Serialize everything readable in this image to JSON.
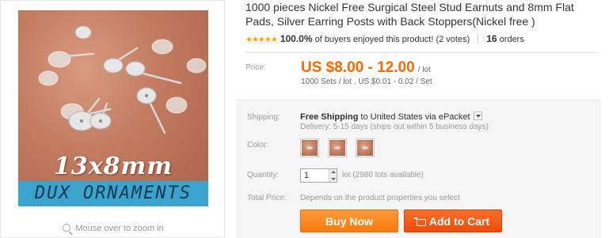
{
  "product": {
    "title": "1000 pieces Nickel Free Surgical Steel Stud Earnuts and 8mm Flat Pads, Silver Earring Posts with Back Stoppers(Nickel free )",
    "image_overlay_size": "13x8mm",
    "image_overlay_brand": "DUX ORNAMENTS",
    "zoom_hint": "Mouse over to zoom in"
  },
  "rating": {
    "stars": "★★★★★",
    "percent": "100.0%",
    "text": " of buyers enjoyed this product! (2 votes)",
    "orders_count": "16",
    "orders_label": " orders",
    "star_color": "#f7a20d"
  },
  "price": {
    "label": "Price:",
    "value": "US $8.00 - 12.00",
    "unit": "/ lot",
    "sub": "1000 Sets / lot , US $0.01 - 0.02 / Set",
    "color": "#ff6600"
  },
  "shipping": {
    "label": "Shipping:",
    "free": "Free Shipping",
    "to": " to ",
    "destination": "United States via ePacket",
    "delivery": "Delivery: 5-15 days (ships out within 5 business days)"
  },
  "color": {
    "label": "Color:",
    "swatches": [
      "swatch-1",
      "swatch-2",
      "swatch-3"
    ]
  },
  "quantity": {
    "label": "Quantity:",
    "value": "1",
    "unit_text": "lot (2980 lots available)"
  },
  "total": {
    "label": "Total Price:",
    "text": "Depends on the product properties you select"
  },
  "buttons": {
    "buy": "Buy Now",
    "cart": "Add to Cart",
    "buy_color": "#f77b0f",
    "cart_color": "#ea4b0b"
  }
}
